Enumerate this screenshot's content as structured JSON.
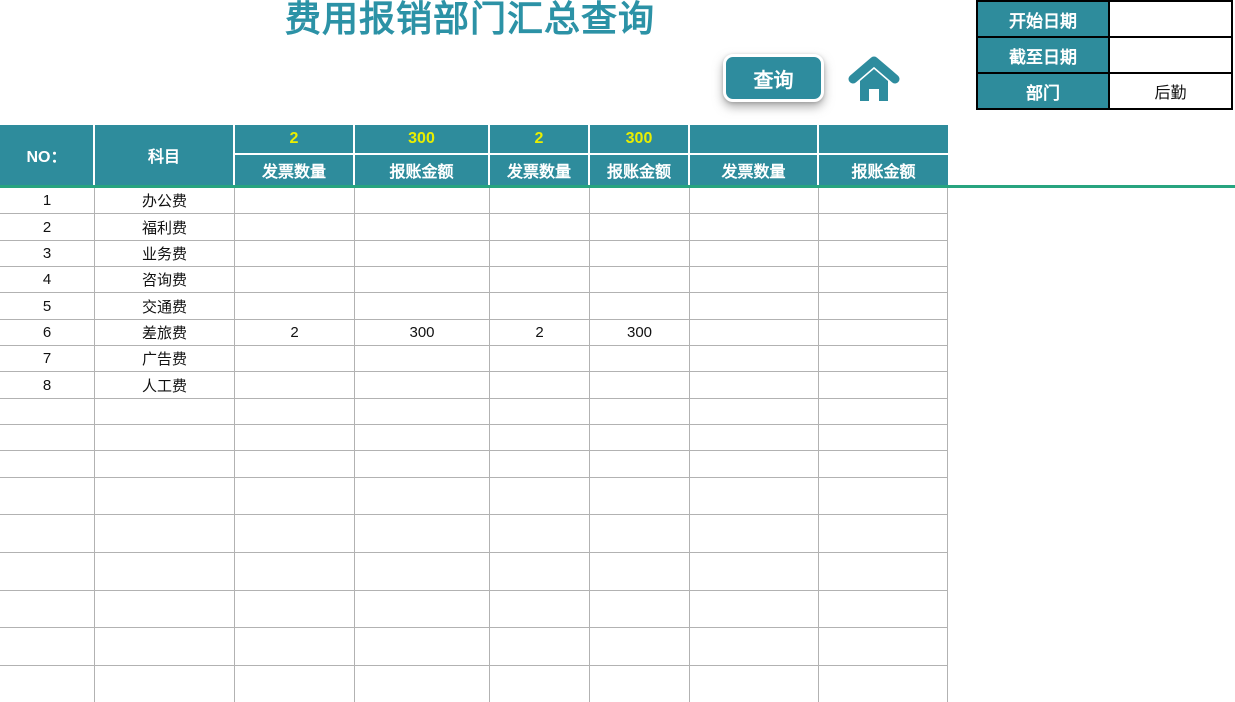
{
  "title": "费用报销部门汇总查询",
  "toolbar": {
    "query_label": "查询"
  },
  "filters": {
    "rows": [
      {
        "label": "开始日期",
        "value": ""
      },
      {
        "label": "截至日期",
        "value": ""
      },
      {
        "label": "部门",
        "value": "后勤"
      }
    ]
  },
  "table": {
    "no_header": "NO：",
    "subject_header": "科目",
    "group_headers": [
      {
        "value": "2",
        "label": "发票数量"
      },
      {
        "value": "300",
        "label": "报账金额"
      },
      {
        "value": "2",
        "label": "发票数量"
      },
      {
        "value": "300",
        "label": "报账金额"
      },
      {
        "value": "",
        "label": "发票数量"
      },
      {
        "value": "",
        "label": "报账金额"
      }
    ],
    "rows": [
      {
        "no": "1",
        "subject": "办公费",
        "values": [
          "",
          "",
          "",
          "",
          "",
          ""
        ]
      },
      {
        "no": "2",
        "subject": "福利费",
        "values": [
          "",
          "",
          "",
          "",
          "",
          ""
        ]
      },
      {
        "no": "3",
        "subject": "业务费",
        "values": [
          "",
          "",
          "",
          "",
          "",
          ""
        ]
      },
      {
        "no": "4",
        "subject": "咨询费",
        "values": [
          "",
          "",
          "",
          "",
          "",
          ""
        ]
      },
      {
        "no": "5",
        "subject": "交通费",
        "values": [
          "",
          "",
          "",
          "",
          "",
          ""
        ]
      },
      {
        "no": "6",
        "subject": "差旅费",
        "values": [
          "2",
          "300",
          "2",
          "300",
          "",
          ""
        ]
      },
      {
        "no": "7",
        "subject": "广告费",
        "values": [
          "",
          "",
          "",
          "",
          "",
          ""
        ]
      },
      {
        "no": "8",
        "subject": "人工费",
        "values": [
          "",
          "",
          "",
          "",
          "",
          ""
        ]
      },
      {
        "no": "",
        "subject": "",
        "values": [
          "",
          "",
          "",
          "",
          "",
          ""
        ]
      },
      {
        "no": "",
        "subject": "",
        "values": [
          "",
          "",
          "",
          "",
          "",
          ""
        ]
      },
      {
        "no": "",
        "subject": "",
        "values": [
          "",
          "",
          "",
          "",
          "",
          ""
        ]
      },
      {
        "no": "",
        "subject": "",
        "values": [
          "",
          "",
          "",
          "",
          "",
          ""
        ]
      },
      {
        "no": "",
        "subject": "",
        "values": [
          "",
          "",
          "",
          "",
          "",
          ""
        ]
      },
      {
        "no": "",
        "subject": "",
        "values": [
          "",
          "",
          "",
          "",
          "",
          ""
        ]
      },
      {
        "no": "",
        "subject": "",
        "values": [
          "",
          "",
          "",
          "",
          "",
          ""
        ]
      },
      {
        "no": "",
        "subject": "",
        "values": [
          "",
          "",
          "",
          "",
          "",
          ""
        ]
      },
      {
        "no": "",
        "subject": "",
        "values": [
          "",
          "",
          "",
          "",
          "",
          ""
        ]
      }
    ]
  },
  "colors": {
    "teal": "#2e8c9c",
    "title_teal": "#2c92a6",
    "accent_yellow": "#e9ee00",
    "green_line": "#27a47f",
    "grid_gray": "#b2b2b2",
    "border_black": "#000000"
  }
}
